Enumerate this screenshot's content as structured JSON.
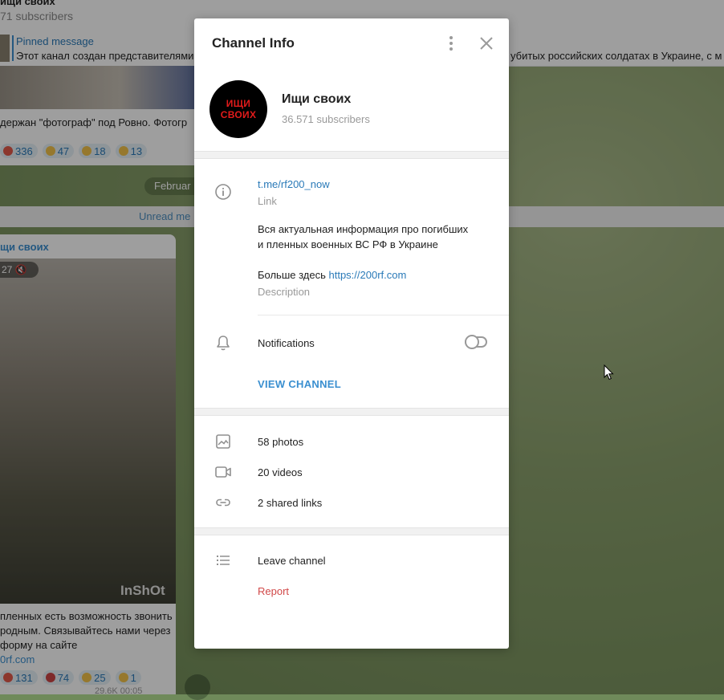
{
  "background_chat": {
    "channel_name": "ищи своих",
    "subscribers": "71 subscribers",
    "pinned": {
      "label": "Pinned message",
      "text_left": "Этот канал создан представителями",
      "text_right": "убитых российских солдатах в Украине, с м"
    },
    "msg1": {
      "text": "держан \"фотограф\" под Ровно. Фотогр",
      "reactions": [
        "336",
        "47",
        "18",
        "13"
      ]
    },
    "date_pill": "Februar",
    "unread_label": "Unread me",
    "msg2": {
      "author": "щи своих",
      "duration": "27",
      "watermark": "InShOt",
      "text": "пленных есть возможность звонить родным. Связывайтесь нами через форму на сайте",
      "link": "0rf.com",
      "reactions": [
        "131",
        "74",
        "25",
        "1"
      ],
      "views": "29.6K  00:05"
    }
  },
  "modal": {
    "title": "Channel Info",
    "avatar_lines": [
      "ИЩИ",
      "СВОИХ"
    ],
    "channel_name": "Ищи своих",
    "subscribers": "36.571 subscribers",
    "link": "t.me/rf200_now",
    "link_caption": "Link",
    "description_line1": "Вся актуальная информация про погибших",
    "description_line2": "и пленных военных ВС РФ в Украине",
    "description_more": "Больше здесь",
    "description_url": "https://200rf.com",
    "description_caption": "Description",
    "notifications_label": "Notifications",
    "notifications_on": false,
    "view_channel": "VIEW CHANNEL",
    "media": {
      "photos": "58 photos",
      "videos": "20 videos",
      "links": "2 shared links"
    },
    "leave": "Leave channel",
    "report": "Report"
  },
  "colors": {
    "accent": "#3a8fd0",
    "danger": "#d14848",
    "avatar_text": "#e21b1b"
  }
}
